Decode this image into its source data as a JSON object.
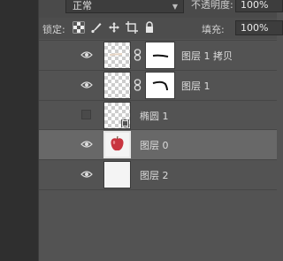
{
  "header": {
    "blend_mode": "正常",
    "opacity_label": "不透明度:",
    "opacity_value": "100%"
  },
  "lock_bar": {
    "lock_label": "锁定:",
    "lock_icons": [
      "lock-transparent-pixels-icon",
      "lock-image-pixels-icon",
      "lock-position-icon",
      "lock-artboard-icon",
      "lock-all-icon"
    ],
    "fill_label": "填充:",
    "fill_value": "100%"
  },
  "layers": [
    {
      "name": "图层 1 拷贝",
      "visible": true,
      "thumb": "transparent",
      "mask": "stroke-line",
      "selected": false
    },
    {
      "name": "图层 1",
      "visible": true,
      "thumb": "transparent",
      "mask": "stroke-curve",
      "selected": false
    },
    {
      "name": "椭圆 1",
      "visible": false,
      "thumb": "transparent-shape",
      "mask": null,
      "selected": false
    },
    {
      "name": "图层 0",
      "visible": true,
      "thumb": "apple",
      "mask": null,
      "selected": true
    },
    {
      "name": "图层 2",
      "visible": true,
      "thumb": "white",
      "mask": null,
      "selected": false
    }
  ],
  "colors": {
    "panel_bg": "#535353",
    "selected_row_bg": "#686868",
    "apple_red": "#c8343f"
  }
}
